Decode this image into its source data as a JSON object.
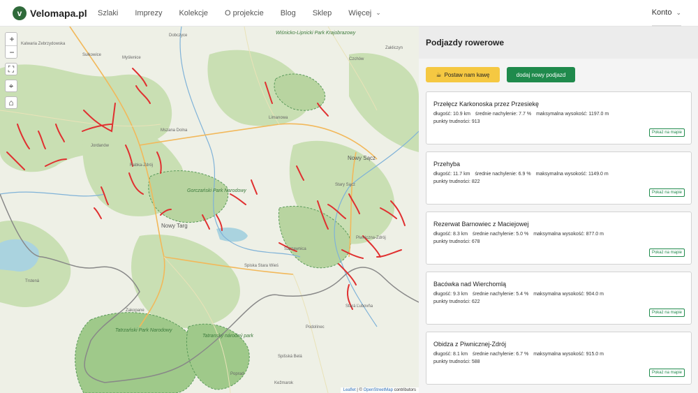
{
  "brand": {
    "name": "Velomapa.pl"
  },
  "nav": {
    "links": [
      "Szlaki",
      "Imprezy",
      "Kolekcje",
      "O projekcie",
      "Blog",
      "Sklep",
      "Więcej"
    ],
    "account": "Konto"
  },
  "map": {
    "controls": {
      "zoom_in": "+",
      "zoom_out": "−",
      "fullscreen": "⛶",
      "locate": "⌖",
      "home": "⌂"
    },
    "labels": [
      "Kalwaria Zebrzydowska",
      "Dobczyce",
      "Wiśnicko-Lipnicki Park Krajobrazowy",
      "Zakliczyn",
      "Sułkowice",
      "Myślenice",
      "Czchów",
      "Limanowa",
      "Mszana Dolna",
      "Jordanów",
      "Rabka-Zdrój",
      "Nowy Sącz",
      "Nowy Targ",
      "Gorczański Park Narodowy",
      "Stary Sącz",
      "Szczawnica",
      "Piwniczna-Zdrój",
      "Spiska Stara Wieś",
      "Trstená",
      "Zakopane",
      "Tatrzański Park Narodowy",
      "Tatranský národný park",
      "Stará Ľubovňa",
      "Poprad",
      "Spišská Belá",
      "Kežmarok",
      "Podolínec"
    ],
    "attribution": {
      "leaflet": "Leaflet",
      "sep": " | © ",
      "osm": "OpenStreetMap",
      "suffix": " contributors"
    }
  },
  "panel": {
    "title": "Podjazdy rowerowe",
    "coffee_button": "Postaw nam kawę",
    "add_button": "dodaj nowy podjazd",
    "show_on_map": "Pokaż na mapie",
    "climbs": [
      {
        "name": "Przełęcz Karkonoska przez Przesiekę",
        "length": "długość: 10.9 km",
        "gradient": "średnie nachylenie: 7.7 %",
        "max_altitude": "maksymalna wysokość: 1197.0 m",
        "difficulty": "punkty trudności: 913"
      },
      {
        "name": "Przehyba",
        "length": "długość: 11.7 km",
        "gradient": "średnie nachylenie: 6.9 %",
        "max_altitude": "maksymalna wysokość: 1149.0 m",
        "difficulty": "punkty trudności: 822"
      },
      {
        "name": "Rezerwat Barnowiec z Maciejowej",
        "length": "długość: 8.3 km",
        "gradient": "średnie nachylenie: 5.0 %",
        "max_altitude": "maksymalna wysokość: 877.0 m",
        "difficulty": "punkty trudności: 678"
      },
      {
        "name": "Bacówka nad Wierchomlą",
        "length": "długość: 9.3 km",
        "gradient": "średnie nachylenie: 5.4 %",
        "max_altitude": "maksymalna wysokość: 904.0 m",
        "difficulty": "punkty trudności: 622"
      },
      {
        "name": "Obidza z Piwnicznej-Zdrój",
        "length": "długość: 8.1 km",
        "gradient": "średnie nachylenie: 6.7 %",
        "max_altitude": "maksymalna wysokość: 915.0 m",
        "difficulty": "punkty trudności: 588"
      }
    ]
  },
  "colors": {
    "brand_green": "#2f6a3a",
    "button_green": "#1f8a4c",
    "coffee_yellow": "#f5c842",
    "route_red": "#e03030"
  }
}
